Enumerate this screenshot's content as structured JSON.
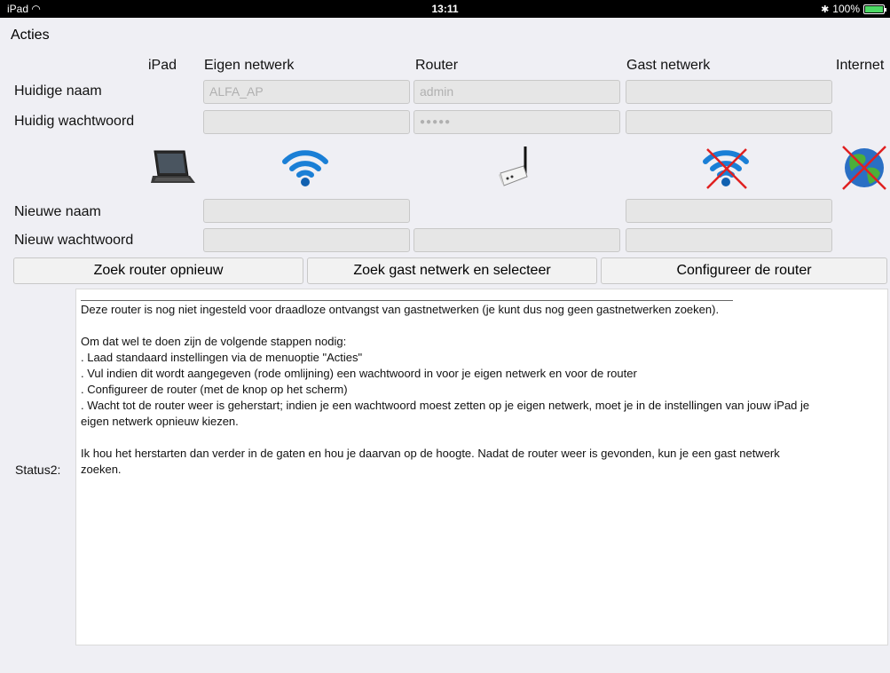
{
  "statusbar": {
    "device": "iPad",
    "time": "13:11",
    "battery": "100%"
  },
  "menu": {
    "acties": "Acties"
  },
  "columns": {
    "ipad": "iPad",
    "eigen_netwerk": "Eigen netwerk",
    "router": "Router",
    "gast_netwerk": "Gast netwerk",
    "internet": "Internet"
  },
  "rows": {
    "huidige_naam": "Huidige naam",
    "huidig_wachtwoord": "Huidig wachtwoord",
    "nieuwe_naam": "Nieuwe naam",
    "nieuw_wachtwoord": "Nieuw wachtwoord"
  },
  "fields": {
    "eigen_huidige_naam": "ALFA_AP",
    "router_huidige_naam": "admin",
    "gast_huidige_naam": "",
    "eigen_huidig_wachtwoord": "",
    "router_huidig_wachtwoord": "●●●●●",
    "gast_huidig_wachtwoord": "",
    "eigen_nieuwe_naam": "",
    "gast_nieuwe_naam": "",
    "eigen_nieuw_wachtwoord": "",
    "router_nieuw_wachtwoord": "",
    "gast_nieuw_wachtwoord": ""
  },
  "icons": {
    "ipad": "ipad-keyboard-icon",
    "eigen_netwerk": "wifi-icon",
    "router": "router-icon",
    "gast_netwerk": "wifi-disconnected-icon",
    "internet": "globe-disconnected-icon"
  },
  "buttons": {
    "zoek_router": "Zoek router opnieuw",
    "zoek_gast": "Zoek gast netwerk en selecteer",
    "configureer": "Configureer de router"
  },
  "status": {
    "label": "Status2:",
    "lines": [
      "Deze router is nog niet ingesteld voor draadloze ontvangst van gastnetwerken (je kunt dus nog geen gastnetwerken zoeken).",
      "",
      "Om dat wel te doen zijn de volgende stappen nodig:",
      ". Laad standaard instellingen via de menuoptie \"Acties\"",
      ". Vul indien dit wordt aangegeven (rode omlijning) een wachtwoord in voor je eigen netwerk en voor de router",
      ". Configureer de router (met de knop op het scherm)",
      ". Wacht tot de router weer is geherstart; indien je een wachtwoord moest zetten op je eigen netwerk, moet je in de instellingen van jouw iPad je",
      "eigen netwerk opnieuw kiezen.",
      "",
      "Ik hou het herstarten dan verder in de gaten en hou je daarvan op de hoogte. Nadat de router weer is gevonden, kun je een gast netwerk",
      "zoeken."
    ]
  }
}
